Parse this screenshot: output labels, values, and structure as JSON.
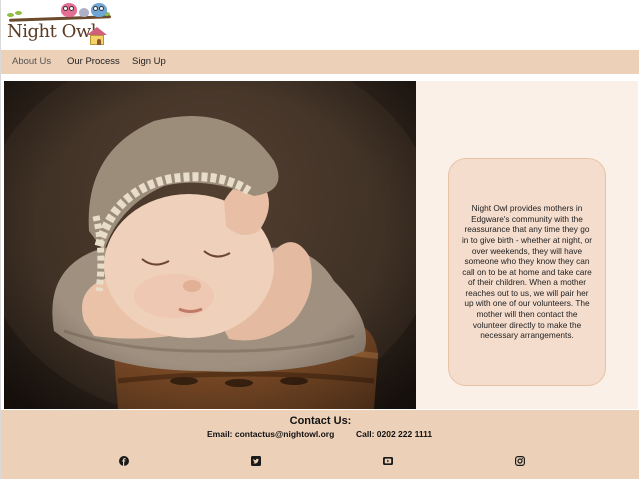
{
  "brand": {
    "name": "Night Owl",
    "logo_icon": "owl-family-on-branch-logo"
  },
  "nav": {
    "items": [
      {
        "label": "About Us",
        "active": true
      },
      {
        "label": "Our Process",
        "active": false
      },
      {
        "label": "Sign Up",
        "active": false
      }
    ]
  },
  "hero": {
    "image": "sleeping-newborn-baby-in-knitted-bonnet-photo",
    "description": "Night Owl provides mothers in Edgware's community with the reassurance that any time they go in to give birth - whether at night, or over weekends, they will have someone who they know they can call on to be at home and take care of their children. When a mother reaches out to us, we will pair her up with one of our volunteers. The mother will then contact the volunteer directly to make the necessary arrangements."
  },
  "footer": {
    "title": "Contact Us:",
    "email_text": "Email: contactus@nightowl.org",
    "phone_text": "Call: 0202 222 1111",
    "social": [
      {
        "icon": "facebook-icon"
      },
      {
        "icon": "twitter-icon"
      },
      {
        "icon": "youtube-icon"
      },
      {
        "icon": "instagram-icon"
      }
    ]
  },
  "colors": {
    "nav_bg": "#ecd0b8",
    "footer_bg": "#ecd0b8",
    "panel_bg": "#faf0e8",
    "card_bg": "#f5ddcd",
    "logo_text": "#5a3b24"
  }
}
